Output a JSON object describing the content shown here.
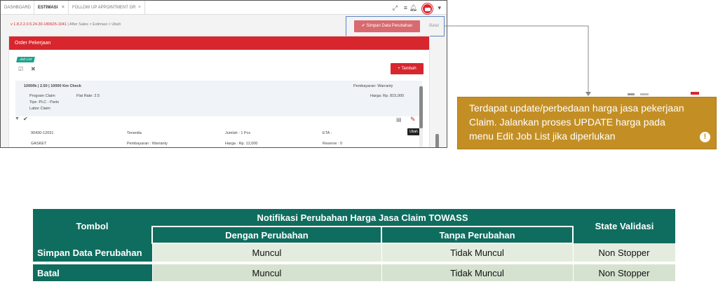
{
  "tabs": [
    {
      "label": "DASHBOARD",
      "active": false
    },
    {
      "label": "ESTIMASI",
      "active": true,
      "close": "×"
    },
    {
      "label": "FOLLOW UP APPOINTMENT GR",
      "active": false,
      "close": "×"
    }
  ],
  "topbar_icons": [
    "expand-icon",
    "menu-icon",
    "bell-icon",
    "avatar"
  ],
  "breadcrumb": {
    "version": "v 1.8.2.2.0.5.24.30-180625-1041",
    "path": " | After Sales > Estimasi > Ubah"
  },
  "actions": {
    "save_label": "Simpan Data Perubahan",
    "save_icon": "✔",
    "cancel_label": "Batal"
  },
  "order": {
    "header": "Order Pekerjaan",
    "badge": "Job List",
    "add_label": "+ Tambah",
    "job": {
      "title": "10000k | 2.50 | 10000 Km Check",
      "lines": [
        "Program Claim",
        "Tipe :PLC - Parts",
        "Labor Claim"
      ],
      "flat_rate": "Flat Rate: 2.5",
      "payment": "Pembayaran: Warranty",
      "price": "Harga: Rp. 815,000"
    },
    "parts": [
      {
        "code": "90430-12031",
        "status": "Tersedia",
        "qty": "Jumlah : 1 Pcs",
        "eta": "ETA :"
      },
      {
        "code": "GASKET",
        "status": "Pembayaran : Warranty",
        "qty": "Harga : Rp. 12,000",
        "eta": "Reserve : 0"
      }
    ],
    "tooltip": "Ubah"
  },
  "notification": {
    "text": "Terdapat update/perbedaan harga jasa pekerjaan Claim. Jalankan proses UPDATE harga pada menu Edit Job List jika diperlukan",
    "icon": "!"
  },
  "table": {
    "col_tombol": "Tombol",
    "col_notif": "Notifikasi Perubahan Harga Jasa Claim TOWASS",
    "col_dengan": "Dengan Perubahan",
    "col_tanpa": "Tanpa Perubahan",
    "col_state": "State Validasi",
    "rows": [
      {
        "label": "Simpan Data Perubahan",
        "dengan": "Muncul",
        "tanpa": "Tidak Muncul",
        "state": "Non Stopper"
      },
      {
        "label": "Batal",
        "dengan": "Muncul",
        "tanpa": "Tidak Muncul",
        "state": "Non Stopper"
      }
    ]
  },
  "colors": {
    "accent": "#d7262e",
    "teal": "#0f6d5f",
    "note": "#c38f25",
    "badge": "#1aa38b"
  }
}
